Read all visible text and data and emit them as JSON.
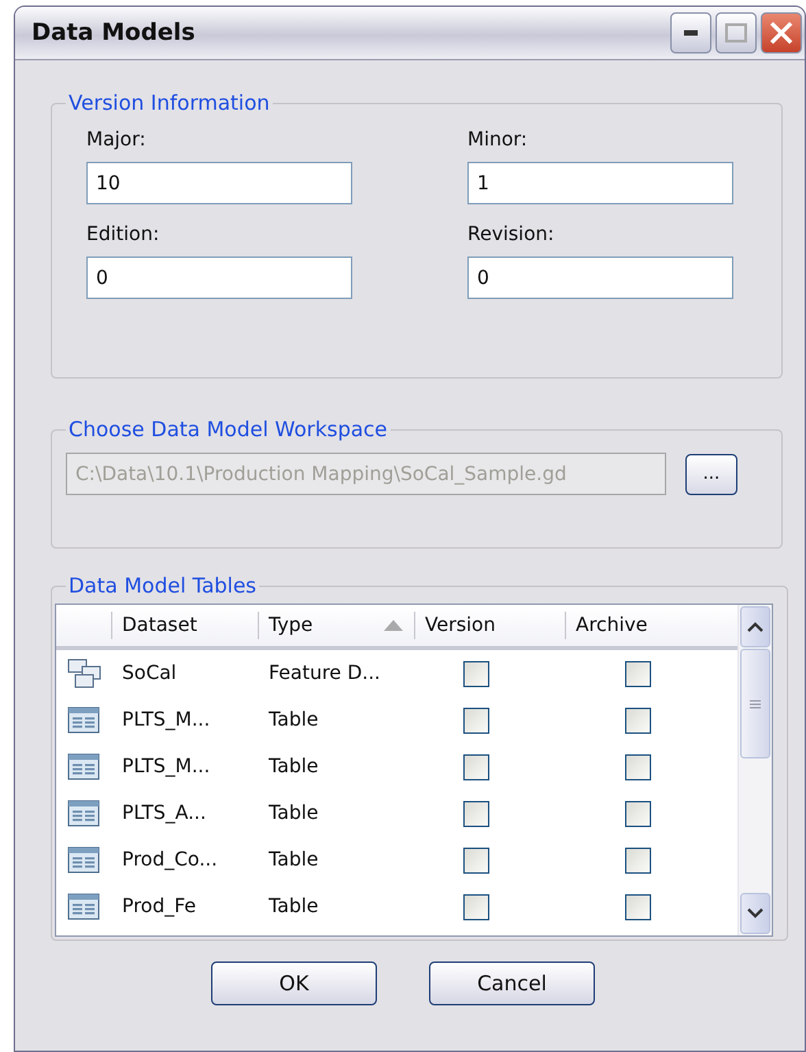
{
  "window": {
    "title": "Data Models"
  },
  "version_information": {
    "title": "Version Information",
    "fields": [
      {
        "label": "Major:",
        "value": "10"
      },
      {
        "label": "Minor:",
        "value": "1"
      },
      {
        "label": "Edition:",
        "value": "0"
      },
      {
        "label": "Revision:",
        "value": "0"
      }
    ]
  },
  "workspace": {
    "title": "Choose  Data Model Workspace",
    "path": "C:\\Data\\10.1\\Production Mapping\\SoCal_Sample.gd",
    "disabled": true,
    "browse_button": "..."
  },
  "tables": {
    "title": "Data Model Tables",
    "columns": [
      {
        "label": "Dataset",
        "sorted": false
      },
      {
        "label": "Type",
        "sorted": true
      },
      {
        "label": "Version",
        "sorted": false
      },
      {
        "label": "Archive",
        "sorted": false
      }
    ],
    "rows": [
      {
        "kind": "feature_dataset",
        "dataset": "SoCal",
        "type": "Feature D...",
        "version": false,
        "archive": false
      },
      {
        "kind": "table",
        "dataset": "PLTS_M...",
        "type": "Table",
        "version": false,
        "archive": false
      },
      {
        "kind": "table",
        "dataset": "PLTS_M...",
        "type": "Table",
        "version": false,
        "archive": false
      },
      {
        "kind": "table",
        "dataset": "PLTS_A...",
        "type": "Table",
        "version": false,
        "archive": false
      },
      {
        "kind": "table",
        "dataset": "Prod_Co...",
        "type": "Table",
        "version": false,
        "archive": false
      },
      {
        "kind": "table",
        "dataset": "Prod_Fe",
        "type": "Table",
        "version": false,
        "archive": false
      }
    ]
  },
  "buttons": [
    "OK",
    "Cancel"
  ]
}
